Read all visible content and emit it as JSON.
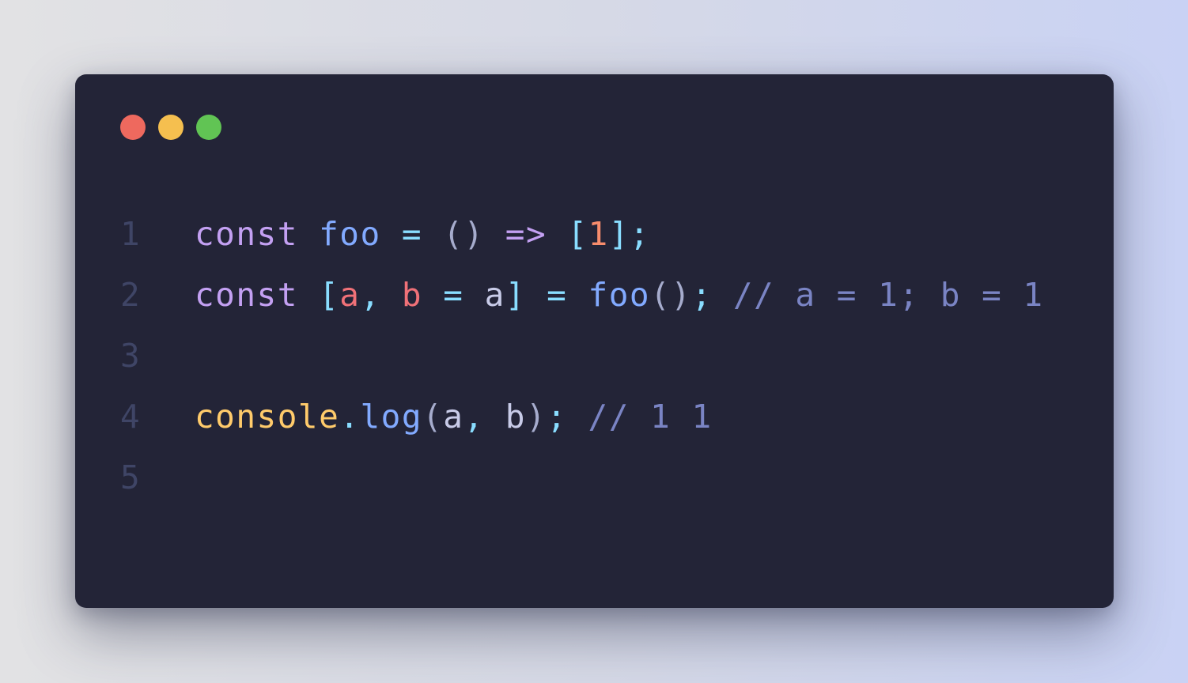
{
  "window": {
    "controls": [
      {
        "name": "close",
        "color": "#ee695e"
      },
      {
        "name": "minimize",
        "color": "#f5bf4f"
      },
      {
        "name": "maximize",
        "color": "#61c454"
      }
    ]
  },
  "colors": {
    "keyword": "#c3a0f2",
    "function": "#82aaff",
    "operator": "#89ddff",
    "paren": "#a6accd",
    "number": "#f78c6c",
    "variable_param": "#f07178",
    "variable": "#c8cbe8",
    "comment": "#7a84c4",
    "class": "#ffcb6b",
    "line_number": "#3f4566"
  },
  "code": {
    "lines": [
      {
        "number": "1",
        "tokens": [
          {
            "text": "const",
            "type": "keyword"
          },
          {
            "text": " ",
            "type": "variable"
          },
          {
            "text": "foo",
            "type": "function"
          },
          {
            "text": " ",
            "type": "variable"
          },
          {
            "text": "=",
            "type": "operator"
          },
          {
            "text": " ",
            "type": "variable"
          },
          {
            "text": "()",
            "type": "paren"
          },
          {
            "text": " ",
            "type": "variable"
          },
          {
            "text": "=>",
            "type": "keyword"
          },
          {
            "text": " ",
            "type": "variable"
          },
          {
            "text": "[",
            "type": "operator"
          },
          {
            "text": "1",
            "type": "number"
          },
          {
            "text": "];",
            "type": "operator"
          }
        ]
      },
      {
        "number": "2",
        "tokens": [
          {
            "text": "const",
            "type": "keyword"
          },
          {
            "text": " ",
            "type": "variable"
          },
          {
            "text": "[",
            "type": "operator"
          },
          {
            "text": "a",
            "type": "variable_param"
          },
          {
            "text": ",",
            "type": "operator"
          },
          {
            "text": " ",
            "type": "variable"
          },
          {
            "text": "b",
            "type": "variable_param"
          },
          {
            "text": " ",
            "type": "variable"
          },
          {
            "text": "=",
            "type": "operator"
          },
          {
            "text": " ",
            "type": "variable"
          },
          {
            "text": "a",
            "type": "variable"
          },
          {
            "text": "]",
            "type": "operator"
          },
          {
            "text": " ",
            "type": "variable"
          },
          {
            "text": "=",
            "type": "operator"
          },
          {
            "text": " ",
            "type": "variable"
          },
          {
            "text": "foo",
            "type": "function"
          },
          {
            "text": "()",
            "type": "paren"
          },
          {
            "text": ";",
            "type": "operator"
          },
          {
            "text": " ",
            "type": "variable"
          },
          {
            "text": "// a = 1; b = 1",
            "type": "comment"
          }
        ]
      },
      {
        "number": "3",
        "tokens": []
      },
      {
        "number": "4",
        "tokens": [
          {
            "text": "console",
            "type": "class"
          },
          {
            "text": ".",
            "type": "operator"
          },
          {
            "text": "log",
            "type": "function"
          },
          {
            "text": "(",
            "type": "paren"
          },
          {
            "text": "a",
            "type": "variable"
          },
          {
            "text": ",",
            "type": "operator"
          },
          {
            "text": " ",
            "type": "variable"
          },
          {
            "text": "b",
            "type": "variable"
          },
          {
            "text": ")",
            "type": "paren"
          },
          {
            "text": ";",
            "type": "operator"
          },
          {
            "text": " ",
            "type": "variable"
          },
          {
            "text": "// 1 1",
            "type": "comment"
          }
        ]
      },
      {
        "number": "5",
        "tokens": []
      }
    ]
  }
}
